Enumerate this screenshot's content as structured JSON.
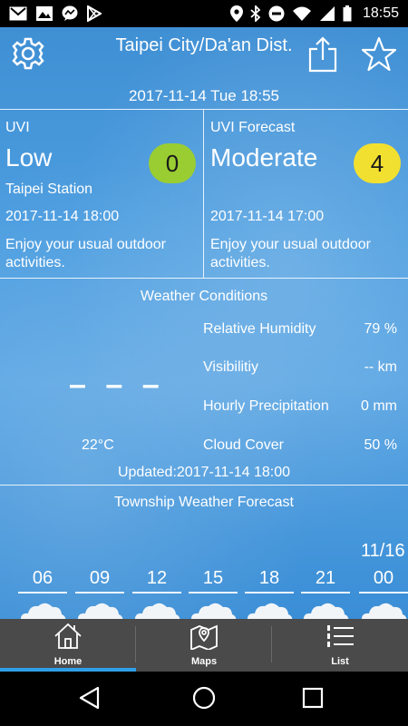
{
  "status_bar": {
    "time": "18:55",
    "icons_left": [
      "gmail-icon",
      "photo-icon",
      "messenger-icon",
      "play-store-icon"
    ],
    "icons_right": [
      "location-icon",
      "bluetooth-icon",
      "do-not-disturb-icon",
      "wifi-icon",
      "signal-icon",
      "battery-icon"
    ]
  },
  "header": {
    "location": "Taipei City/Da'an Dist.",
    "datetime": "2017-11-14 Tue 18:55"
  },
  "uvi_current": {
    "label": "UVI",
    "level": "Low",
    "value": "0",
    "badge_color": "#9acd32",
    "station": "Taipei Station",
    "time": "2017-11-14 18:00",
    "advice": "Enjoy your usual outdoor activities."
  },
  "uvi_forecast": {
    "label": "UVI Forecast",
    "level": "Moderate",
    "value": "4",
    "badge_color": "#f2e030",
    "time": "2017-11-14 17:00",
    "advice": "Enjoy your usual outdoor activities."
  },
  "conditions": {
    "title": "Weather Conditions",
    "temp_placeholder": "– – –",
    "temperature": "22°C",
    "rows": [
      {
        "label": "Relative Humidity",
        "value": "79 %"
      },
      {
        "label": "Visibilitiy",
        "value": "-- km"
      },
      {
        "label": "Hourly Precipitation",
        "value": "0 mm"
      },
      {
        "label": "Cloud Cover",
        "value": "50 %"
      }
    ],
    "updated": "Updated:2017-11-14 18:00"
  },
  "township_forecast": {
    "title": "Township Weather Forecast",
    "date": "11/16",
    "hours": [
      "06",
      "09",
      "12",
      "15",
      "18",
      "21",
      "00"
    ]
  },
  "tabs": [
    {
      "label": "Home",
      "active": true
    },
    {
      "label": "Maps",
      "active": false
    },
    {
      "label": "List",
      "active": false
    }
  ],
  "colors": {
    "accent": "#2fa0e8",
    "tab_bar": "#4a4a4a"
  }
}
